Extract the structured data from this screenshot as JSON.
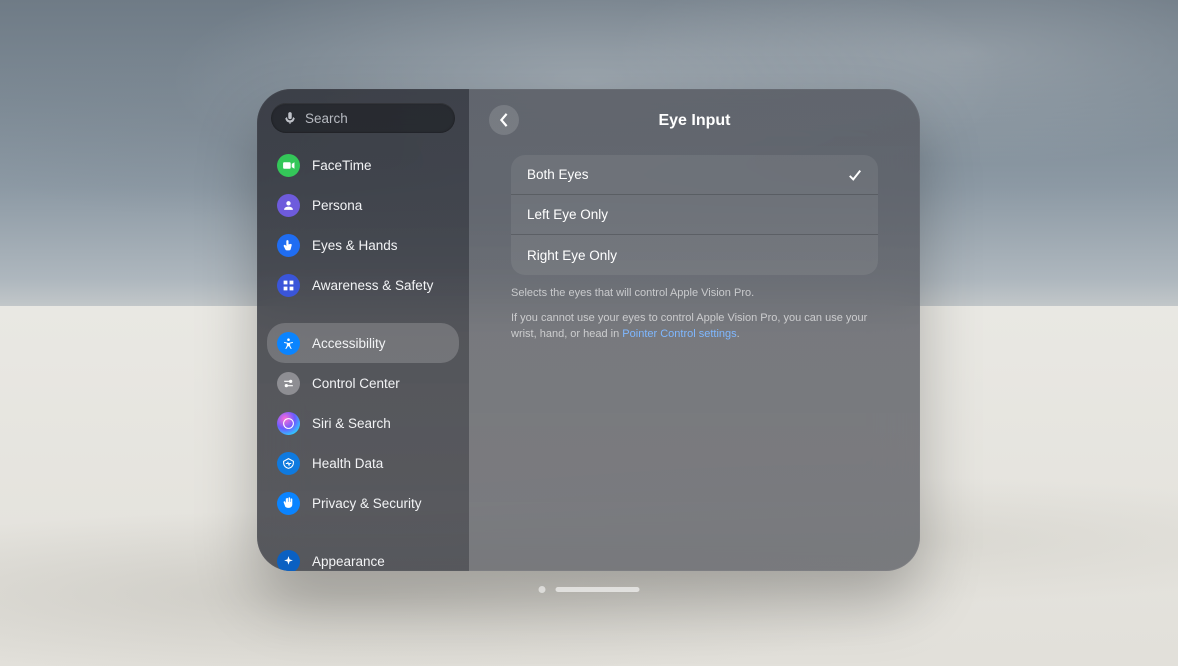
{
  "search": {
    "placeholder": "Search"
  },
  "sidebar": {
    "items": [
      {
        "id": "facetime",
        "label": "FaceTime",
        "icon": "video",
        "bg": "#34c759"
      },
      {
        "id": "persona",
        "label": "Persona",
        "icon": "person",
        "bg": "#6e5bdc"
      },
      {
        "id": "eyes-hands",
        "label": "Eyes & Hands",
        "icon": "hand-point",
        "bg": "#1f6df2"
      },
      {
        "id": "awareness",
        "label": "Awareness & Safety",
        "icon": "grid",
        "bg": "#3a55d9"
      },
      {
        "id": "accessibility",
        "label": "Accessibility",
        "icon": "accessibility",
        "bg": "#0a84ff",
        "selected": true
      },
      {
        "id": "control-center",
        "label": "Control Center",
        "icon": "switches",
        "bg": "#8e8e93"
      },
      {
        "id": "siri",
        "label": "Siri & Search",
        "icon": "siri",
        "bg": "siri"
      },
      {
        "id": "health",
        "label": "Health Data",
        "icon": "health",
        "bg": "#0f7adf"
      },
      {
        "id": "privacy",
        "label": "Privacy & Security",
        "icon": "hand-raised",
        "bg": "#0a84ff"
      },
      {
        "id": "appearance",
        "label": "Appearance",
        "icon": "sparkle",
        "bg": "#0a60c2"
      }
    ]
  },
  "main": {
    "title": "Eye Input",
    "options": [
      {
        "label": "Both Eyes",
        "selected": true
      },
      {
        "label": "Left Eye Only",
        "selected": false
      },
      {
        "label": "Right Eye Only",
        "selected": false
      }
    ],
    "footer1": "Selects the eyes that will control Apple Vision Pro.",
    "footer2_before": "If you cannot use your eyes to control Apple Vision Pro, you can use your wrist, hand, or head in ",
    "footer2_link": "Pointer Control settings",
    "footer2_after": "."
  }
}
